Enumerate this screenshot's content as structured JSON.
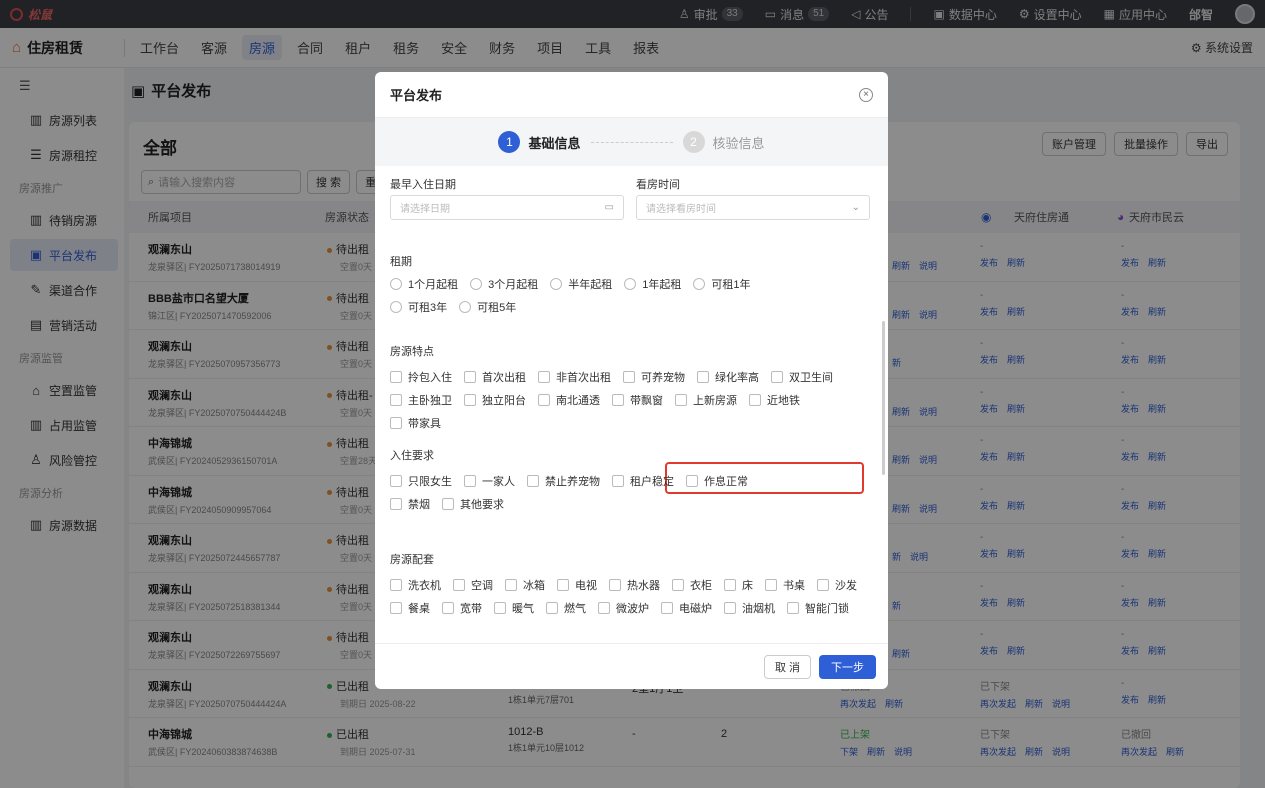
{
  "topbar": {
    "logo": "松鼠",
    "items": [
      {
        "icon": "user-icon",
        "label": "审批",
        "badge": "33"
      },
      {
        "icon": "message-icon",
        "label": "消息",
        "badge": "51"
      },
      {
        "icon": "speaker-icon",
        "label": "公告"
      },
      {
        "icon": "monitor-icon",
        "label": "数据中心"
      },
      {
        "icon": "gear-icon",
        "label": "设置中心"
      },
      {
        "icon": "grid-icon",
        "label": "应用中心"
      }
    ],
    "user": "邰智"
  },
  "navbar": {
    "brand": "住房租赁",
    "tabs": [
      "工作台",
      "客源",
      "房源",
      "合同",
      "租户",
      "租务",
      "安全",
      "财务",
      "项目",
      "工具",
      "报表"
    ],
    "active_tab": "房源",
    "system_settings": "系统设置"
  },
  "sidebar": [
    {
      "type": "item",
      "label": "房源列表",
      "icon": "building-icon"
    },
    {
      "type": "item",
      "label": "房源租控",
      "icon": "list-icon"
    },
    {
      "type": "group",
      "label": "房源推广"
    },
    {
      "type": "item",
      "label": "待销房源",
      "icon": "building-icon"
    },
    {
      "type": "item",
      "label": "平台发布",
      "icon": "publish-icon",
      "active": true
    },
    {
      "type": "item",
      "label": "渠道合作",
      "icon": "edit-icon"
    },
    {
      "type": "item",
      "label": "营销活动",
      "icon": "campaign-icon"
    },
    {
      "type": "group",
      "label": "房源监管"
    },
    {
      "type": "item",
      "label": "空置监管",
      "icon": "home-icon"
    },
    {
      "type": "item",
      "label": "占用监管",
      "icon": "building-icon"
    },
    {
      "type": "item",
      "label": "风险管控",
      "icon": "people-icon"
    },
    {
      "type": "group",
      "label": "房源分析"
    },
    {
      "type": "item",
      "label": "房源数据",
      "icon": "building-icon"
    }
  ],
  "page": {
    "title": "平台发布",
    "card_title": "全部",
    "actions": [
      "账户管理",
      "批量操作",
      "导出"
    ],
    "search_placeholder": "请输入搜索内容",
    "search_button": "搜 索",
    "reset_button": "重置",
    "columns": [
      "所属项目",
      "房源状态",
      "天府住房通",
      "天府市民云"
    ],
    "rows": [
      {
        "name": "观澜东山",
        "code": "龙泉驿区| FY2025071738014919",
        "status": "待出租",
        "status_color": "#e8923b",
        "sub": "空置0天",
        "p1": "-",
        "p1_links": [
          "发布",
          "刷新"
        ],
        "p2": "-",
        "p2_links": [
          "发布",
          "刷新"
        ],
        "left_links": [
          "刷新",
          "说明"
        ]
      },
      {
        "name": "BBB盐市口名望大厦",
        "code": "锦江区| FY2025071470592006",
        "status": "待出租",
        "status_color": "#e8923b",
        "sub": "空置0天",
        "p1": "-",
        "p1_links": [
          "发布",
          "刷新"
        ],
        "p2": "-",
        "p2_links": [
          "发布",
          "刷新"
        ],
        "left_links": [
          "刷新",
          "说明"
        ]
      },
      {
        "name": "观澜东山",
        "code": "龙泉驿区| FY2025070957356773",
        "status": "待出租",
        "status_color": "#e8923b",
        "sub": "空置0天",
        "p1": "-",
        "p1_links": [
          "发布",
          "刷新"
        ],
        "p2": "-",
        "p2_links": [
          "发布",
          "刷新"
        ],
        "left_links": [
          "新"
        ]
      },
      {
        "name": "观澜东山",
        "code": "龙泉驿区| FY2025070750444424B",
        "status": "待出租-",
        "status_color": "#e8923b",
        "sub": "空置0天",
        "p1": "-",
        "p1_links": [
          "发布",
          "刷新"
        ],
        "p2": "-",
        "p2_links": [
          "发布",
          "刷新"
        ],
        "left_links": [
          "刷新",
          "说明"
        ]
      },
      {
        "name": "中海锦城",
        "code": "武侯区| FY2024052936150701A",
        "status": "待出租",
        "status_color": "#e8923b",
        "sub": "空置28天",
        "p1": "-",
        "p1_links": [
          "发布",
          "刷新"
        ],
        "p2": "-",
        "p2_links": [
          "发布",
          "刷新"
        ],
        "left_links": [
          "刷新",
          "说明"
        ]
      },
      {
        "name": "中海锦城",
        "code": "武侯区| FY2024050909957064",
        "status": "待出租",
        "status_color": "#e8923b",
        "sub": "空置0天",
        "p1": "-",
        "p1_links": [
          "发布",
          "刷新"
        ],
        "p2": "-",
        "p2_links": [
          "发布",
          "刷新"
        ],
        "left_links": [
          "刷新",
          "说明"
        ]
      },
      {
        "name": "观澜东山",
        "code": "龙泉驿区| FY2025072445657787",
        "status": "待出租",
        "status_color": "#e8923b",
        "sub": "空置0天",
        "p1": "-",
        "p1_links": [
          "发布",
          "刷新"
        ],
        "p2": "-",
        "p2_links": [
          "发布",
          "刷新"
        ],
        "left_links": [
          "新",
          "说明"
        ]
      },
      {
        "name": "观澜东山",
        "code": "龙泉驿区| FY2025072518381344",
        "status": "待出租",
        "status_color": "#e8923b",
        "sub": "空置0天",
        "p1": "-",
        "p1_links": [
          "发布",
          "刷新"
        ],
        "p2": "-",
        "p2_links": [
          "发布",
          "刷新"
        ],
        "left_links": [
          "新"
        ]
      },
      {
        "name": "观澜东山",
        "code": "龙泉驿区| FY2025072269755697",
        "status": "待出租",
        "status_color": "#e8923b",
        "sub": "空置0天",
        "p1": "-",
        "p1_links": [
          "发布",
          "刷新"
        ],
        "p2": "-",
        "p2_links": [
          "发布",
          "刷新"
        ],
        "left_links": [
          "刷新"
        ]
      },
      {
        "name": "观澜东山",
        "code": "龙泉驿区| FY2025070750444424A",
        "status": "已出租",
        "status_color": "#37b24d",
        "sub": "到期日 2025-08-22",
        "room": "701-A",
        "room_sub": "1栋1单元7层701",
        "layout": "2室1厅1卫",
        "c5": "2",
        "p0": "已撤回",
        "p0_links": [
          "再次发起",
          "刷新"
        ],
        "p1": "已下架",
        "p1_links": [
          "再次发起",
          "刷新",
          "说明"
        ],
        "p2": "-",
        "p2_links": [
          "发布",
          "刷新"
        ]
      },
      {
        "name": "中海锦城",
        "code": "武侯区| FY2024060383874638B",
        "status": "已出租",
        "status_color": "#37b24d",
        "sub": "到期日 2025-07-31",
        "room": "1012-B",
        "room_sub": "1栋1单元10层1012",
        "layout": "-",
        "c5": "2",
        "p0": "已上架",
        "p0_links": [
          "下架",
          "刷新",
          "说明"
        ],
        "p1": "已下架",
        "p1_links": [
          "再次发起",
          "刷新",
          "说明"
        ],
        "p2": "已撤回",
        "p2_links": [
          "再次发起",
          "刷新"
        ]
      }
    ]
  },
  "modal": {
    "title": "平台发布",
    "steps": [
      {
        "num": "1",
        "label": "基础信息"
      },
      {
        "num": "2",
        "label": "核验信息"
      }
    ],
    "earliest_date_label": "最早入住日期",
    "earliest_date_placeholder": "请选择日期",
    "viewing_time_label": "看房时间",
    "viewing_time_placeholder": "请选择看房时间",
    "lease_label": "租期",
    "lease_options": [
      "1个月起租",
      "3个月起租",
      "半年起租",
      "1年起租",
      "可租1年",
      "可租3年",
      "可租5年"
    ],
    "features_label": "房源特点",
    "features": [
      "拎包入住",
      "首次出租",
      "非首次出租",
      "可养宠物",
      "绿化率高",
      "双卫生间",
      "主卧独卫",
      "独立阳台",
      "南北通透",
      "带飘窗",
      "上新房源",
      "近地铁",
      "带家具"
    ],
    "requirements_label": "入住要求",
    "requirements": [
      "只限女生",
      "一家人",
      "禁止养宠物",
      "租户稳定",
      "作息正常",
      "禁烟",
      "其他要求"
    ],
    "facilities_label": "房源配套",
    "facilities": [
      "洗衣机",
      "空调",
      "冰箱",
      "电视",
      "热水器",
      "衣柜",
      "床",
      "书桌",
      "沙发",
      "餐桌",
      "宽带",
      "暖气",
      "燃气",
      "微波炉",
      "电磁炉",
      "油烟机",
      "智能门锁"
    ],
    "cancel": "取 消",
    "next": "下一步"
  }
}
